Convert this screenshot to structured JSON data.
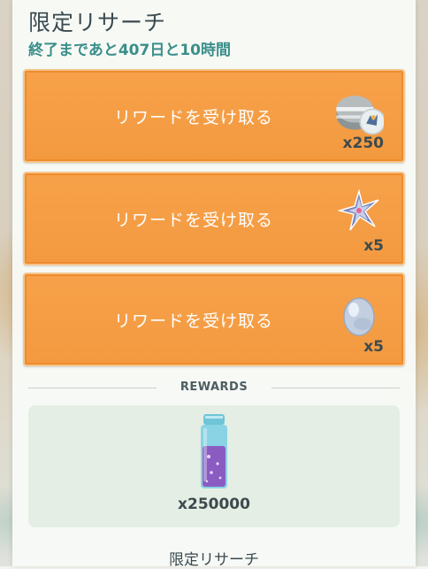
{
  "header": {
    "title": "限定リサーチ",
    "countdown": "終了まであと407日と10時間"
  },
  "rewards_to_claim": [
    {
      "label": "リワードを受け取る",
      "quantity": "x250",
      "icon": "stardust-and-pokemon-encounter-icon"
    },
    {
      "label": "リワードを受け取る",
      "quantity": "x5",
      "icon": "sinnoh-stone-icon"
    },
    {
      "label": "リワードを受け取る",
      "quantity": "x5",
      "icon": "rare-candy-egg-icon"
    }
  ],
  "rewards_section": {
    "heading": "REWARDS",
    "item_icon": "super-incubator-potion-icon",
    "amount": "x250000"
  },
  "footer": {
    "label": "限定リサーチ"
  },
  "colors": {
    "button_orange": "#f39a40",
    "accent_teal": "#3a8f8a",
    "panel_green": "#e4eee4"
  }
}
